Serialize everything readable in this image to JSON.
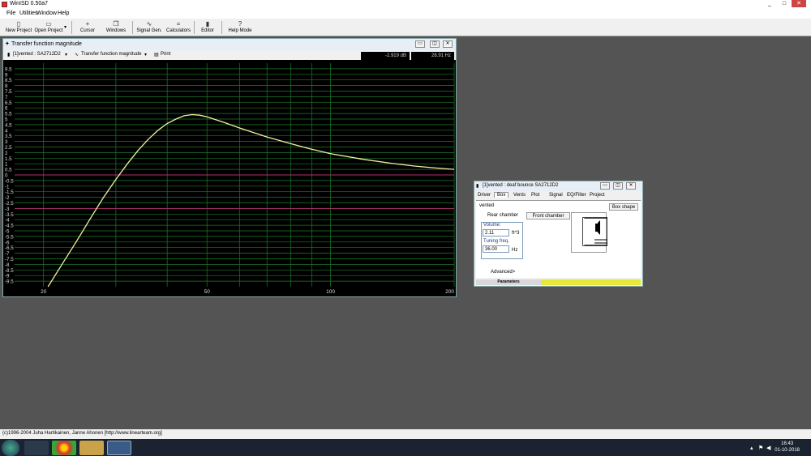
{
  "app": {
    "title": "WinISD 0.50a7",
    "controls": [
      "_",
      "□",
      "✕"
    ]
  },
  "menu": [
    "File",
    "Utilities",
    "Window",
    "Help"
  ],
  "toolbar": {
    "new_project": "New Project",
    "open_project": "Open Project",
    "cursor": "Cursor",
    "windows": "Windows",
    "signal_gen": "Signal Gen.",
    "calculators": "Calculators",
    "editor": "Editor",
    "help_mode": "Help Mode"
  },
  "chart_window": {
    "title": "Transfer function magnitude",
    "driver_select": "[1]vented : SA2712D2",
    "graph_select": "Transfer function magnitude",
    "print": "Print",
    "readout_db": "-2.919 dB",
    "readout_hz": "28.91 Hz",
    "controls": [
      "▭",
      "◫",
      "✕"
    ]
  },
  "chart_data": {
    "type": "line",
    "xscale": "log",
    "xlim": [
      17,
      200
    ],
    "ylim": [
      -10,
      10
    ],
    "x_tick_labels": [
      "20",
      "50",
      "100",
      "200"
    ],
    "y_tick_labels": [
      "9.5",
      "9",
      "8.5",
      "8",
      "7.5",
      "7",
      "6.5",
      "6",
      "5.5",
      "5",
      "4.5",
      "4",
      "3.5",
      "3",
      "2.5",
      "2",
      "1.5",
      "1",
      "0.5",
      "0",
      "-0.5",
      "-1",
      "-1.5",
      "-2",
      "-2.5",
      "-3",
      "-3.5",
      "-4",
      "-4.5",
      "-5",
      "-5.5",
      "-6",
      "-6.5",
      "-7",
      "-7.5",
      "-8",
      "-8.5",
      "-9",
      "-9.5"
    ],
    "grid": true,
    "reference_lines": [
      0,
      -3
    ],
    "series": [
      {
        "color": "#f5f0a0",
        "x": [
          20.5,
          22,
          24,
          26,
          28,
          30,
          32,
          34,
          36,
          38,
          40,
          42,
          44,
          46,
          48,
          50,
          55,
          60,
          70,
          80,
          90,
          100,
          120,
          140,
          160,
          180,
          200
        ],
        "y": [
          -10,
          -8.2,
          -6.0,
          -3.9,
          -2.0,
          -0.4,
          1.0,
          2.2,
          3.2,
          4.0,
          4.6,
          5.0,
          5.3,
          5.4,
          5.35,
          5.2,
          4.7,
          4.2,
          3.4,
          2.8,
          2.3,
          1.9,
          1.4,
          1.05,
          0.8,
          0.62,
          0.5
        ]
      }
    ]
  },
  "colors": {
    "curve": "#f5f0a0",
    "grid": "#1f7a2a",
    "zero_line": "#b0306a",
    "status_yellow": "#e8e83a"
  },
  "box_window": {
    "title": "[1]vented : deaf bounce SA2712D2",
    "controls": [
      "▭",
      "◫",
      "✕"
    ],
    "tabs": [
      "Driver",
      "Box",
      "Vents",
      "Plot",
      "Signal",
      "EQ/Filter",
      "Project"
    ],
    "active_tab": "Box",
    "box_type": "vented",
    "rear_chamber": "Rear chamber",
    "front_chamber": "Front chamber",
    "box_shape_button": "Box shape",
    "volume_label": "Volume:",
    "volume_value": "2.11",
    "volume_unit": "ft^3",
    "tuning_label": "Tuning freq.",
    "tuning_value": "36.00",
    "tuning_unit": "Hz",
    "advanced": "Advanced>",
    "parameters": "Parameters"
  },
  "status": {
    "copyright": "(c)1996-2004 Juha Hartikainen, Janne Ahonen [http://www.linearteam.org]"
  },
  "taskbar": {
    "time": "16:43",
    "date": "01-10-2018"
  }
}
